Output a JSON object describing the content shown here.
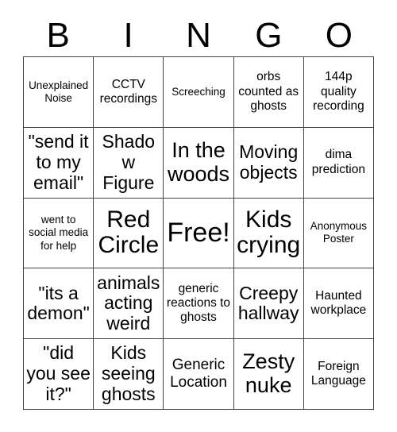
{
  "card": {
    "title": "BINGO",
    "header_letters": [
      "B",
      "I",
      "N",
      "G",
      "O"
    ],
    "grid_size": "5x5",
    "free_space_label": "Free!",
    "text_color": "#000000",
    "background_color": "#ffffff",
    "border_color": "#444444",
    "cells": [
      {
        "text": "Unexplained Noise",
        "size": "fs-s",
        "free": false
      },
      {
        "text": "CCTV recordings",
        "size": "fs-m",
        "free": false
      },
      {
        "text": "Screeching",
        "size": "fs-s",
        "free": false
      },
      {
        "text": "orbs counted as ghosts",
        "size": "fs-m",
        "free": false
      },
      {
        "text": "144p quality recording",
        "size": "fs-m",
        "free": false
      },
      {
        "text": "\"send it to my email\"",
        "size": "fs-xl",
        "free": false
      },
      {
        "text": "Shadow Figure",
        "size": "fs-xl",
        "free": false
      },
      {
        "text": "In the woods",
        "size": "fs-2xl",
        "free": false
      },
      {
        "text": "Moving objects",
        "size": "fs-xl",
        "free": false
      },
      {
        "text": "dima prediction",
        "size": "fs-m",
        "free": false
      },
      {
        "text": "went to social media for help",
        "size": "fs-s",
        "free": false
      },
      {
        "text": "Red Circle",
        "size": "fs-3xl",
        "free": false
      },
      {
        "text": "Free!",
        "size": "fs-4xl",
        "free": true
      },
      {
        "text": "Kids crying",
        "size": "fs-3xl",
        "free": false
      },
      {
        "text": "Anonymous Poster",
        "size": "fs-s",
        "free": false
      },
      {
        "text": "\"its a demon\"",
        "size": "fs-xl",
        "free": false
      },
      {
        "text": "animals acting weird",
        "size": "fs-xl",
        "free": false
      },
      {
        "text": "generic reactions to ghosts",
        "size": "fs-m",
        "free": false
      },
      {
        "text": "Creepy hallway",
        "size": "fs-xl",
        "free": false
      },
      {
        "text": "Haunted workplace",
        "size": "fs-m",
        "free": false
      },
      {
        "text": "\"did you see it?\"",
        "size": "fs-xl",
        "free": false
      },
      {
        "text": "Kids seeing ghosts",
        "size": "fs-xl",
        "free": false
      },
      {
        "text": "Generic Location",
        "size": "fs-l",
        "free": false
      },
      {
        "text": "Zesty nuke",
        "size": "fs-2xl",
        "free": false
      },
      {
        "text": "Foreign Language",
        "size": "fs-m",
        "free": false
      }
    ]
  }
}
